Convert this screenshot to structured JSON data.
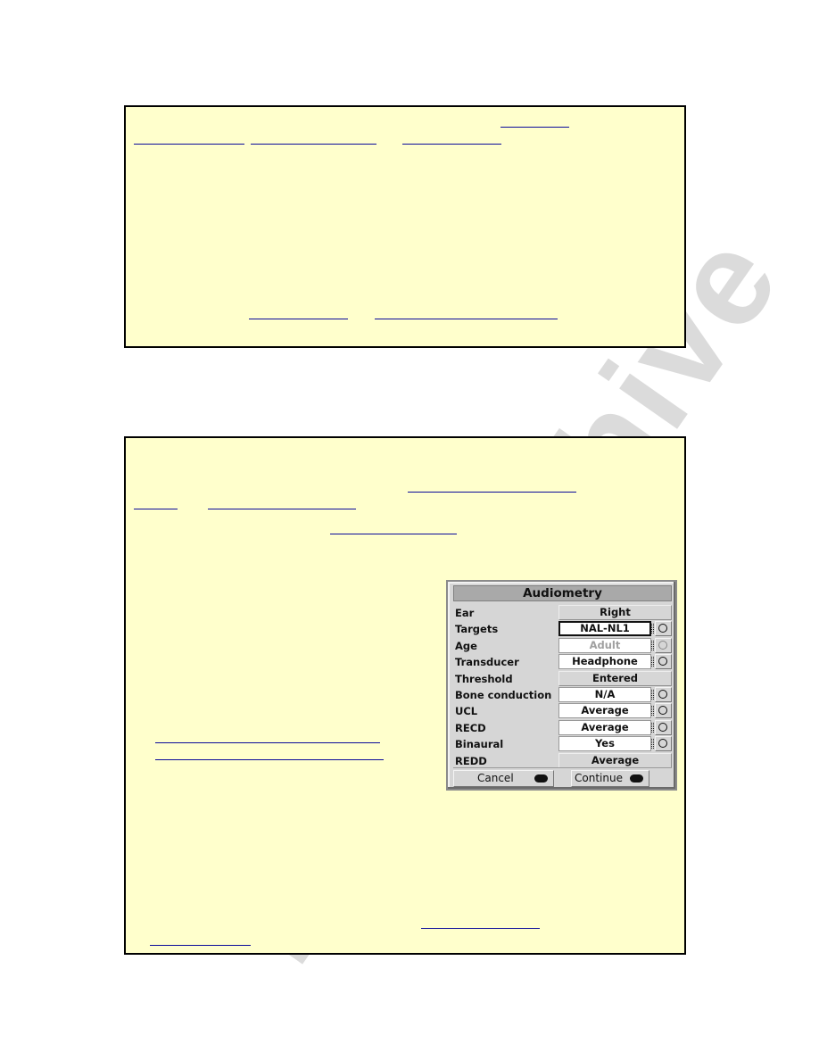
{
  "watermark": "manualshive",
  "section1": {
    "links": [
      "",
      "",
      "",
      "",
      "",
      "",
      ""
    ]
  },
  "section2": {
    "links": [
      "",
      "",
      "",
      "",
      "",
      "",
      "",
      "",
      ""
    ]
  },
  "dialog": {
    "title": "Audiometry",
    "rows": [
      {
        "label": "Ear",
        "value": "Right",
        "type": "static"
      },
      {
        "label": "Targets",
        "value": "NAL-NL1",
        "type": "select",
        "state": "active"
      },
      {
        "label": "Age",
        "value": "Adult",
        "type": "select",
        "state": "disabled"
      },
      {
        "label": "Transducer",
        "value": "Headphone",
        "type": "select"
      },
      {
        "label": "Threshold",
        "value": "Entered",
        "type": "static"
      },
      {
        "label": "Bone conduction",
        "value": "N/A",
        "type": "select"
      },
      {
        "label": "UCL",
        "value": "Average",
        "type": "select"
      },
      {
        "label": "RECD",
        "value": "Average",
        "type": "select"
      },
      {
        "label": "Binaural",
        "value": "Yes",
        "type": "select"
      },
      {
        "label": "REDD",
        "value": "Average",
        "type": "static"
      }
    ],
    "buttons": {
      "cancel": "Cancel",
      "continue": "Continue"
    }
  },
  "colors": {
    "background": "#ffffcc",
    "link": "#0a0a9a",
    "dialog": "#d6d6d6"
  }
}
